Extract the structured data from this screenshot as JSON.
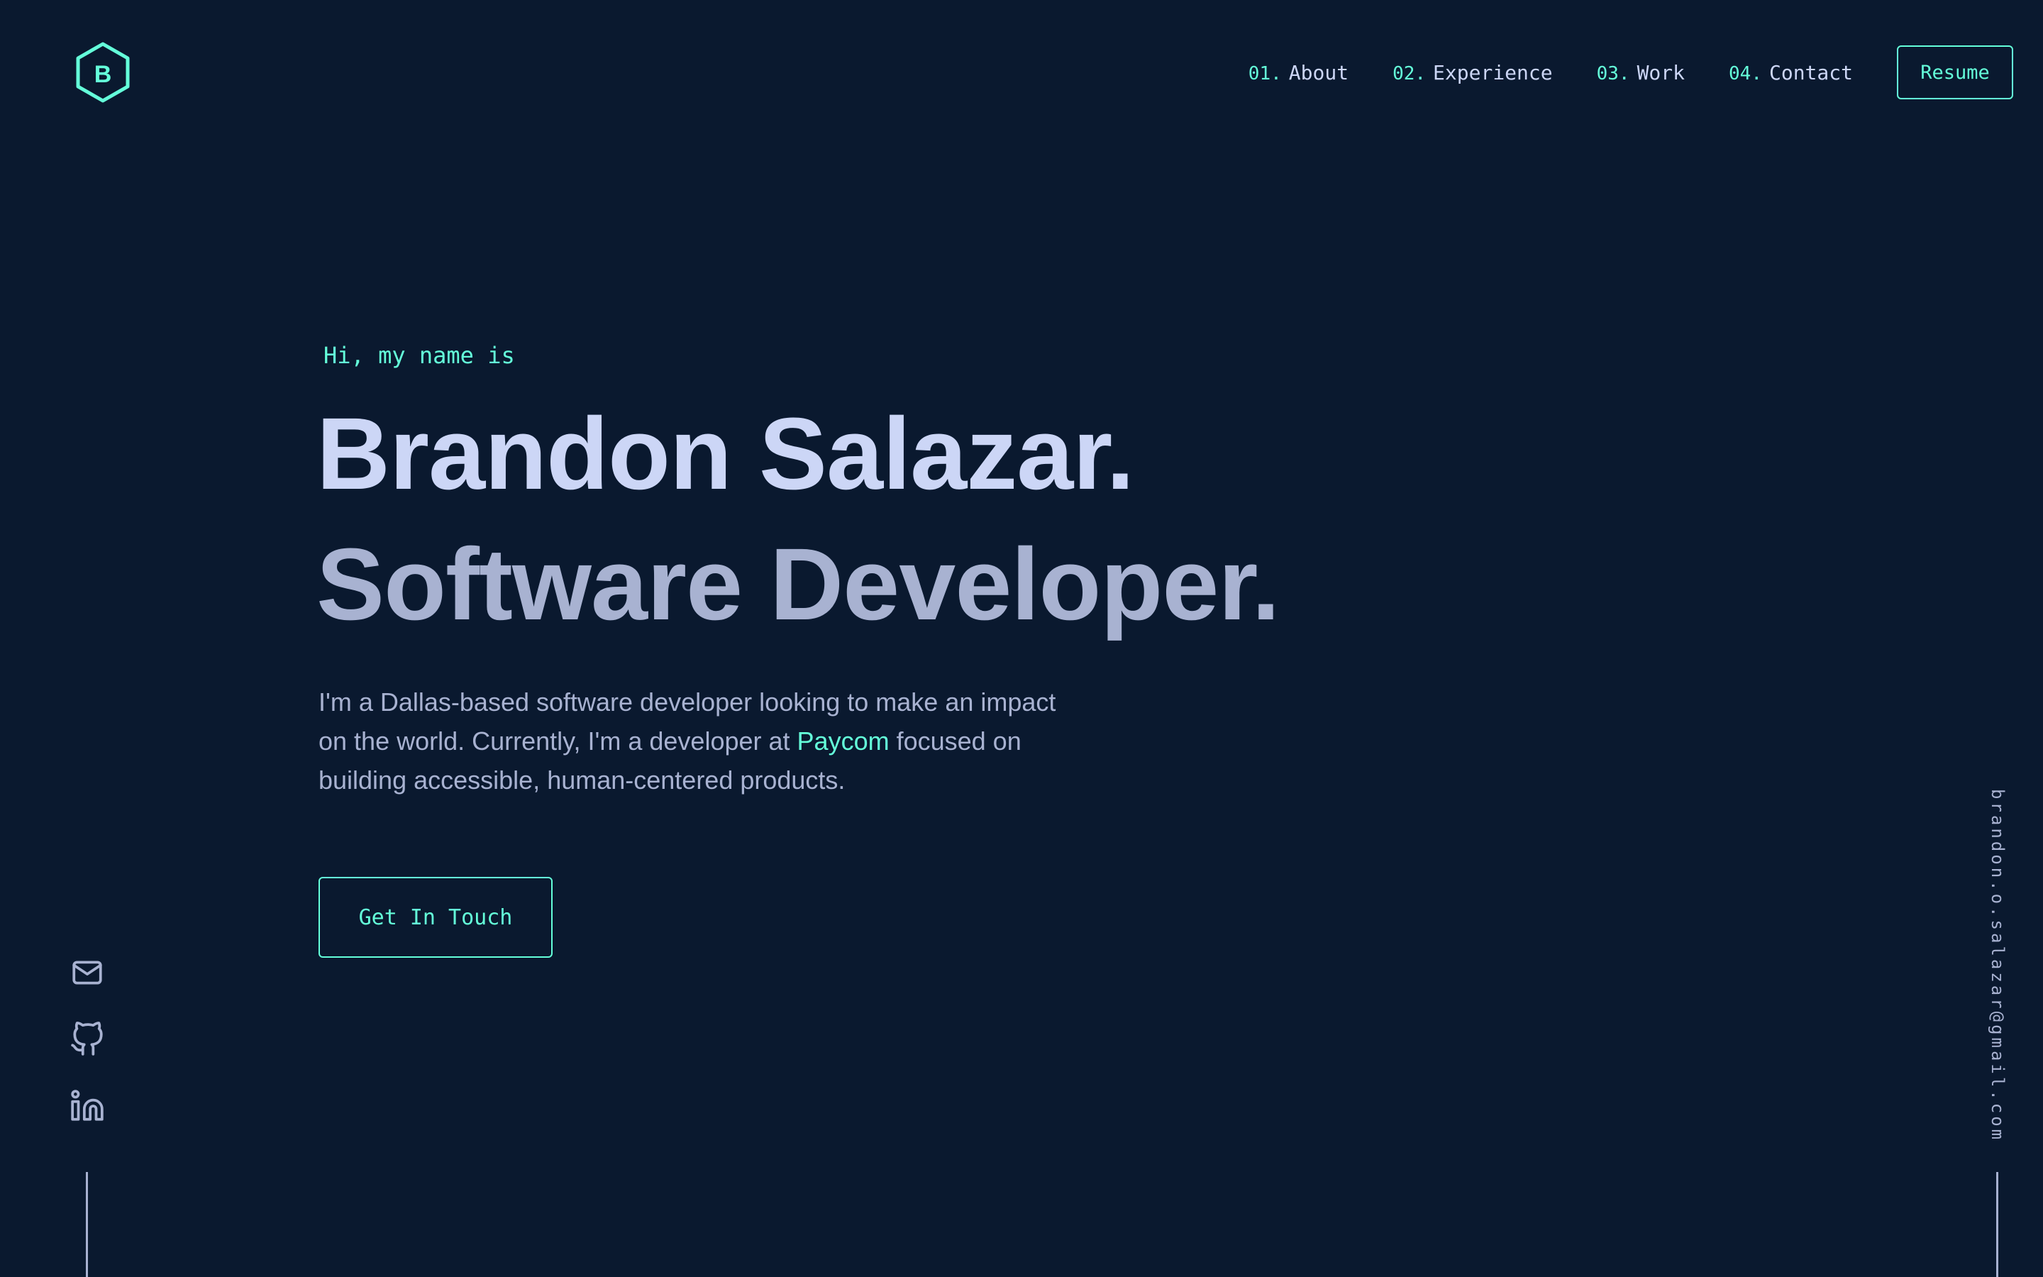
{
  "colors": {
    "background": "#0a192f",
    "accent": "#64ffda",
    "heading": "#ccd6f6",
    "subheading": "#a8b2d1",
    "text": "#a8b2d1"
  },
  "header": {
    "logo_letter": "B",
    "logo_icon": "hexagon-icon",
    "nav": [
      {
        "num": "01.",
        "label": "About"
      },
      {
        "num": "02.",
        "label": "Experience"
      },
      {
        "num": "03.",
        "label": "Work"
      },
      {
        "num": "04.",
        "label": "Contact"
      }
    ],
    "resume_label": "Resume"
  },
  "hero": {
    "intro": "Hi, my name is",
    "name": "Brandon Salazar.",
    "role": "Software Developer.",
    "bio": {
      "line1": "I'm a Dallas-based software developer looking to make an impact",
      "line2_prefix": "on the world. Currently, I'm a developer at ",
      "company": "Paycom",
      "line2_suffix": " focused on",
      "line3": "building accessible, human-centered products."
    },
    "cta_label": "Get In Touch"
  },
  "social": {
    "icons": [
      "mail-icon",
      "github-icon",
      "linkedin-icon"
    ]
  },
  "email": "brandon.o.salazar@gmail.com"
}
